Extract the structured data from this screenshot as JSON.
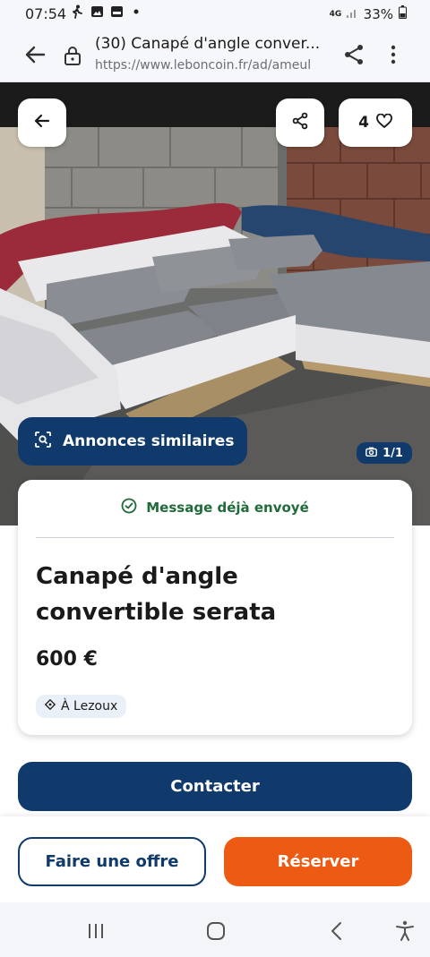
{
  "status_bar": {
    "time": "07:54",
    "network": "4G",
    "battery": "33%",
    "icons": [
      "walking-icon",
      "gallery-icon",
      "hdr-icon",
      "dot-icon"
    ]
  },
  "browser": {
    "page_title": "(30) Canapé d'angle conver...",
    "url": "https://www.leboncoin.fr/ad/ameul",
    "icons": [
      "back-arrow-icon",
      "lock-icon",
      "share-icon",
      "more-vert-icon"
    ]
  },
  "hero": {
    "favorites_count": "4",
    "similar_label": "Annonces similaires",
    "photo_counter": "1/1",
    "icons": [
      "back-arrow-icon",
      "share-icon",
      "heart-icon",
      "similar-search-icon",
      "camera-icon"
    ]
  },
  "card": {
    "message_status": "Message déjà envoyé",
    "title": "Canapé d'angle convertible serata",
    "price": "600 €",
    "location": "À Lezoux",
    "status_color": "#1f6b3a"
  },
  "actions": {
    "contact_label": "Contacter",
    "offer_label": "Faire une offre",
    "reserve_label": "Réserver",
    "primary_color": "#0f3a6b",
    "accent_color": "#ec5a13"
  },
  "nav": {
    "icons": [
      "recents-icon",
      "home-icon",
      "back-icon",
      "accessibility-icon"
    ]
  }
}
